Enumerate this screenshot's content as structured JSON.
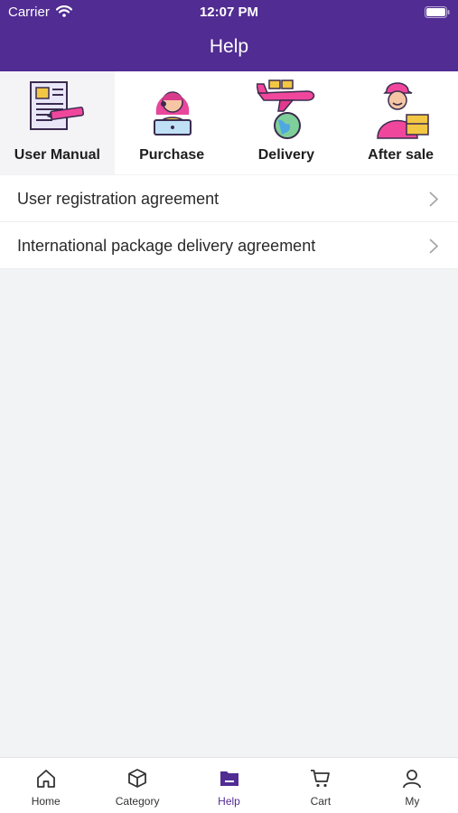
{
  "status": {
    "carrier": "Carrier",
    "time": "12:07 PM"
  },
  "header": {
    "title": "Help"
  },
  "categories": [
    {
      "label": "User Manual",
      "icon": "manual-icon",
      "active": true
    },
    {
      "label": "Purchase",
      "icon": "purchase-icon",
      "active": false
    },
    {
      "label": "Delivery",
      "icon": "delivery-icon",
      "active": false
    },
    {
      "label": "After sale",
      "icon": "after-sale-icon",
      "active": false
    }
  ],
  "list": {
    "items": [
      {
        "label": "User registration agreement"
      },
      {
        "label": "International package delivery agreement"
      }
    ]
  },
  "tabbar": {
    "items": [
      {
        "label": "Home",
        "icon": "home-icon"
      },
      {
        "label": "Category",
        "icon": "category-icon"
      },
      {
        "label": "Help",
        "icon": "help-icon",
        "active": true
      },
      {
        "label": "Cart",
        "icon": "cart-icon"
      },
      {
        "label": "My",
        "icon": "user-icon"
      }
    ]
  },
  "colors": {
    "brand": "#512c93",
    "background": "#f2f3f5"
  }
}
